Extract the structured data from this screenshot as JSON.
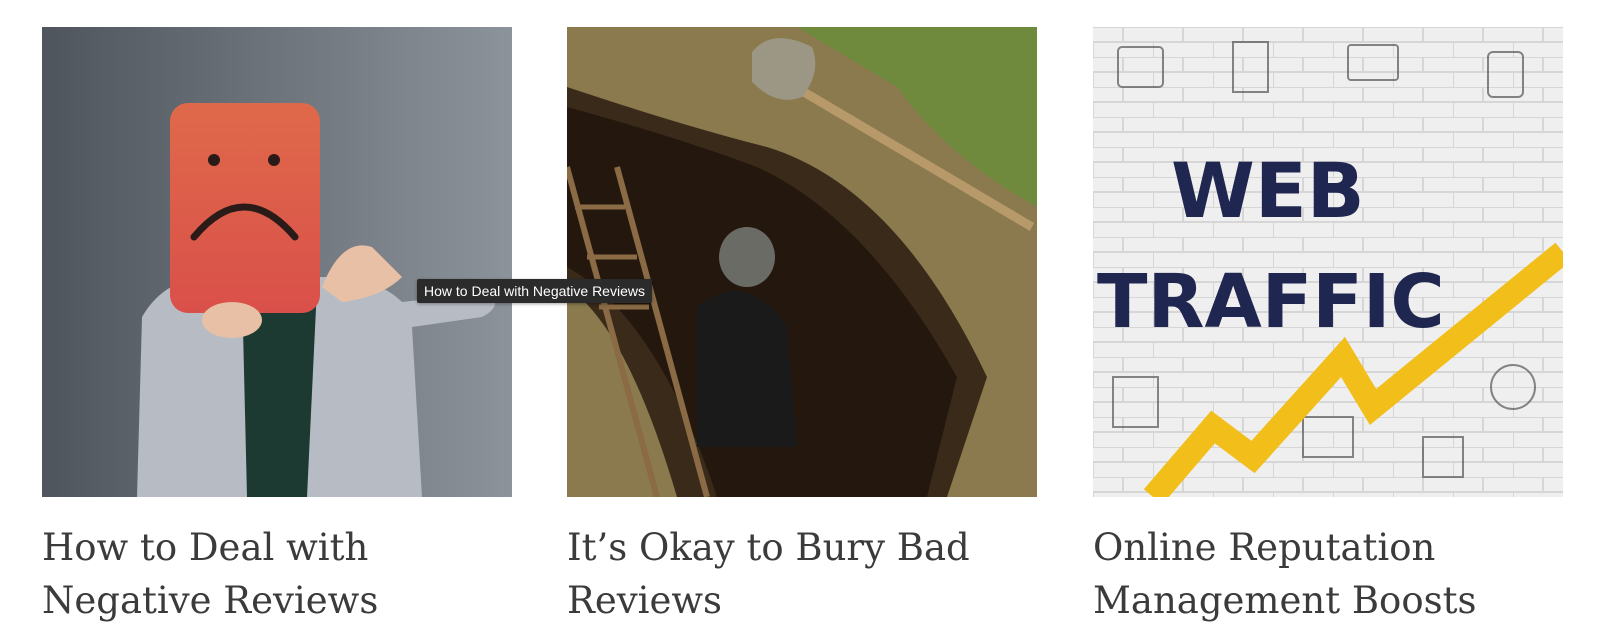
{
  "posts": [
    {
      "title_line1": "How to Deal with",
      "title_line2": "Negative Reviews",
      "image_alt": "Person holding sad face sign giving thumbs down"
    },
    {
      "title_line1": "It’s Okay to Bury Bad",
      "title_line2": "Reviews",
      "image_alt": "Man standing in a dug grave with shovel"
    },
    {
      "title_line1": "Online Reputation",
      "title_line2": "Management Boosts",
      "image_alt": "WEB TRAFFIC brick wall graphic",
      "image_text_1": "WEB",
      "image_text_2": "TRAFFIC"
    }
  ],
  "tooltip": {
    "text": "How to Deal with Negative Reviews"
  },
  "colors": {
    "title": "#3b3b3b",
    "sad_face": "#df5a48",
    "web_text": "#1f2650",
    "arrow": "#f2be1a"
  }
}
